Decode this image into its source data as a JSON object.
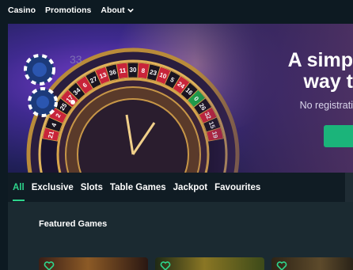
{
  "nav": {
    "items": [
      "Casino",
      "Promotions",
      "About"
    ]
  },
  "hero": {
    "headline_line1": "A simp",
    "headline_line2": "way t",
    "subtext": "No registrati",
    "wheel_numbers": [
      "33",
      "21",
      "4",
      "2",
      "25",
      "17",
      "34",
      "6",
      "27",
      "13",
      "36",
      "11",
      "30",
      "8",
      "23",
      "10",
      "5",
      "24",
      "16",
      "0",
      "26",
      "32",
      "15",
      "19"
    ]
  },
  "categories": [
    "All",
    "Exclusive",
    "Slots",
    "Table Games",
    "Jackpot",
    "Favourites"
  ],
  "featured": {
    "title": "Featured Games"
  },
  "colors": {
    "accent_green": "#2ed58c",
    "cta_green": "#1bb47a",
    "background": "#0d1a22"
  }
}
